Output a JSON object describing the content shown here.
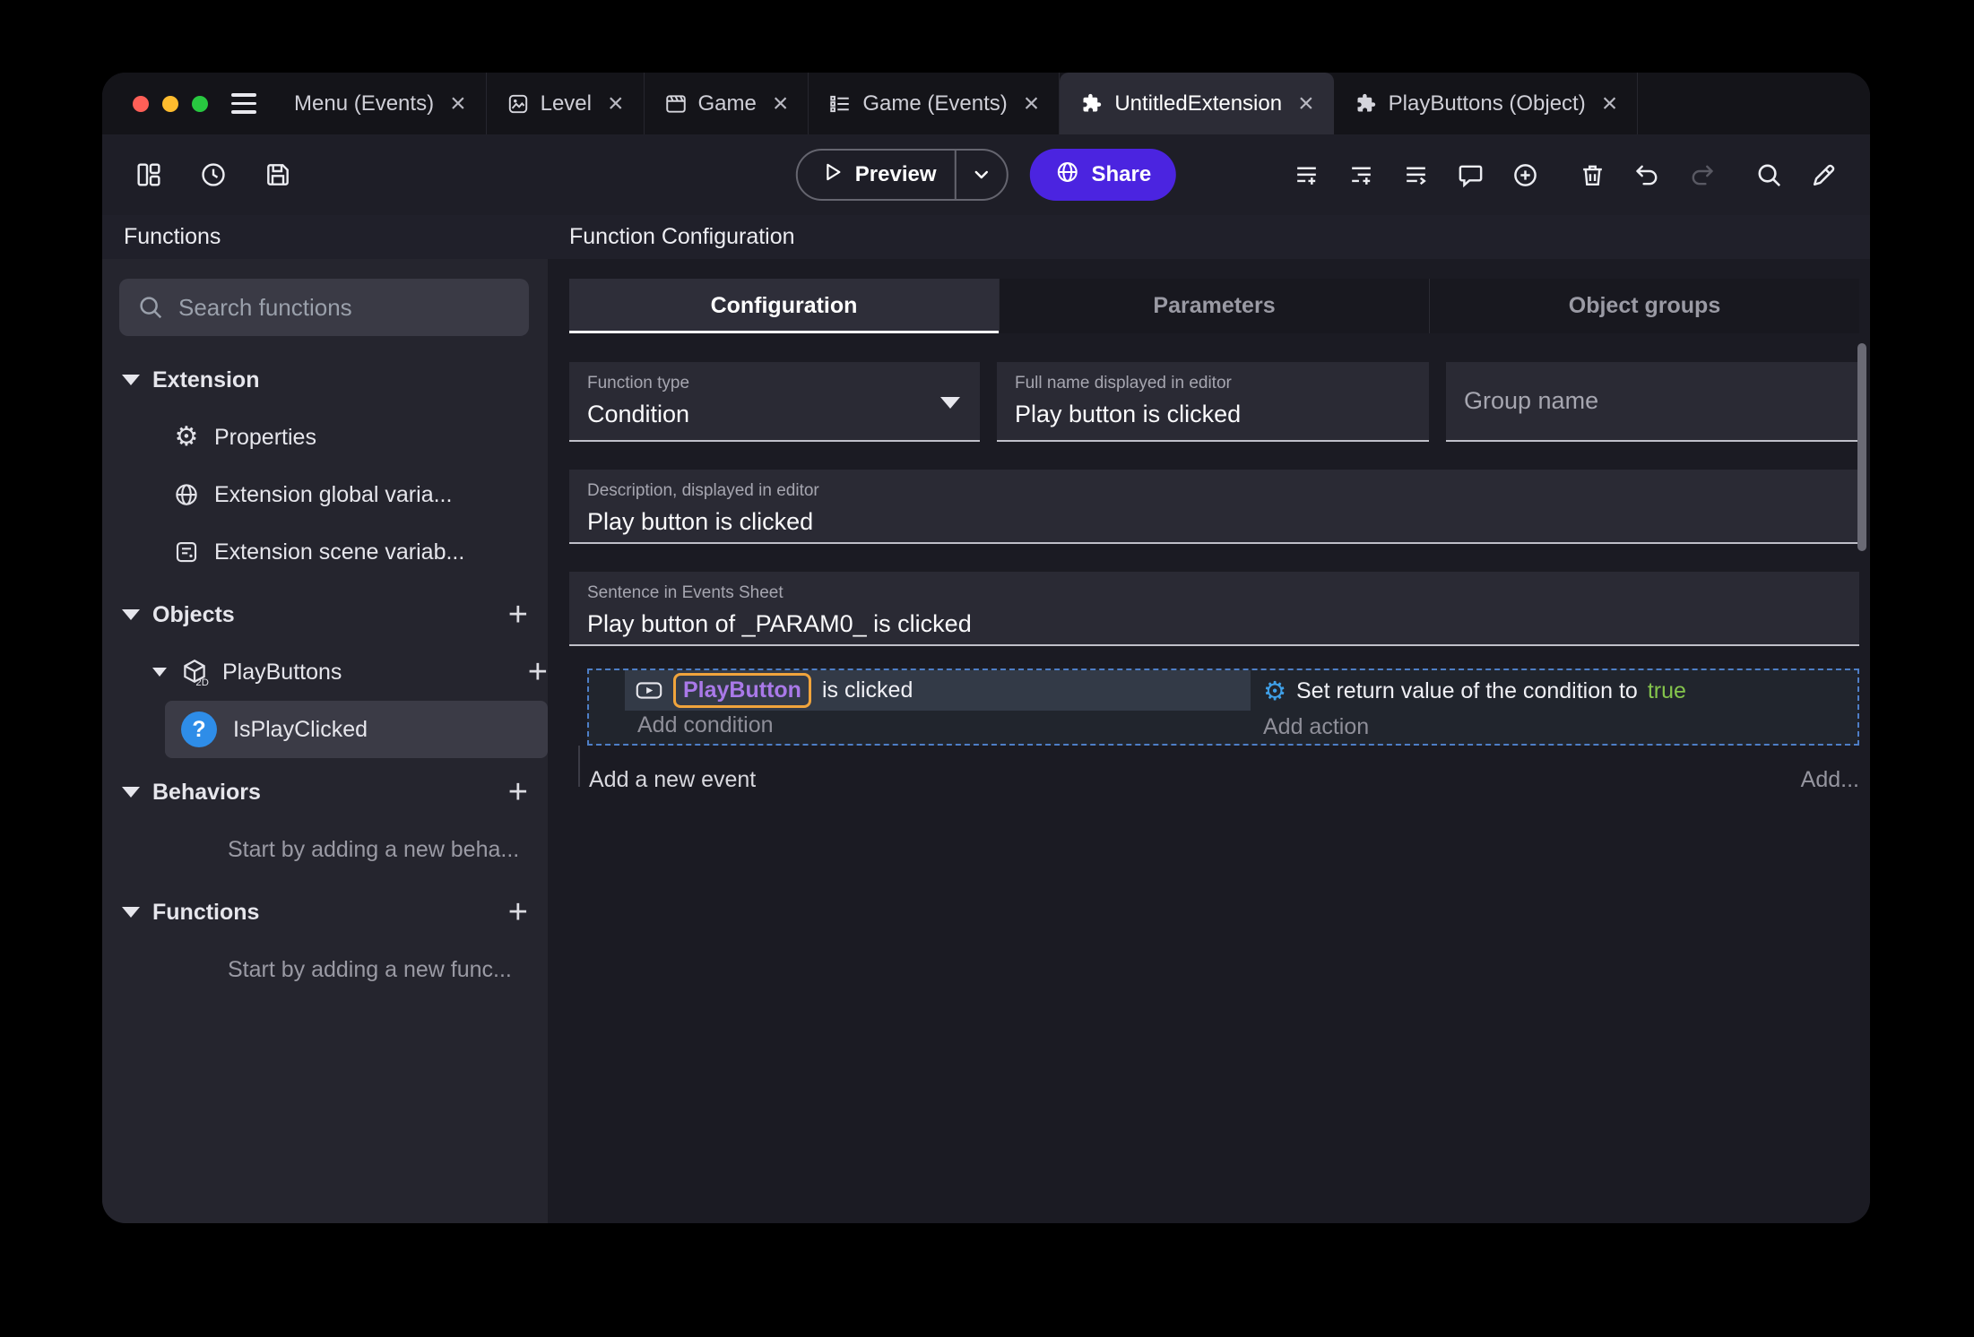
{
  "icons": {
    "close": "×",
    "plus": "+",
    "gear": "⚙",
    "question": "?"
  },
  "colors": {
    "share_button": "#4b24e0",
    "active_tab": "#2c2c36",
    "object_chip_border": "#f0a43c",
    "object_chip_text": "#a979e8",
    "condition_true_green": "#84c44c",
    "action_gear_blue": "#3fa0e8"
  },
  "tabbar": {
    "tabs": [
      {
        "label": "Menu (Events)"
      },
      {
        "label": "Level",
        "icon": "scene-icon"
      },
      {
        "label": "Game",
        "icon": "game-icon"
      },
      {
        "label": "Game (Events)",
        "icon": "events-sheet-icon"
      },
      {
        "label": "UntitledExtension",
        "icon": "extension-icon",
        "active": true
      },
      {
        "label": "PlayButtons (Object)",
        "icon": "extension-icon"
      }
    ]
  },
  "toolbar": {
    "preview_label": "Preview",
    "share_label": "Share"
  },
  "sidebar": {
    "title": "Functions",
    "search_placeholder": "Search functions",
    "tree": {
      "extension": {
        "label": "Extension",
        "items": [
          "Properties",
          "Extension global varia...",
          "Extension scene variab..."
        ]
      },
      "objects": {
        "label": "Objects",
        "object": {
          "label": "PlayButtons",
          "function": "IsPlayClicked"
        }
      },
      "behaviors": {
        "label": "Behaviors",
        "hint": "Start by adding a new beha..."
      },
      "functions": {
        "label": "Functions",
        "hint": "Start by adding a new func..."
      }
    }
  },
  "main": {
    "title": "Function Configuration",
    "tabs": [
      {
        "label": "Configuration",
        "active": true
      },
      {
        "label": "Parameters"
      },
      {
        "label": "Object groups"
      }
    ],
    "form": {
      "function_type": {
        "label": "Function type",
        "value": "Condition"
      },
      "full_name": {
        "label": "Full name displayed in editor",
        "value": "Play button is clicked"
      },
      "group_name": {
        "placeholder": "Group name"
      },
      "description": {
        "label": "Description, displayed in editor",
        "value": "Play button is clicked"
      },
      "sentence": {
        "label": "Sentence in Events Sheet",
        "value": "Play button of _PARAM0_ is clicked"
      }
    },
    "events": {
      "condition_object": "PlayButton",
      "condition_text": "is clicked",
      "add_condition": "Add condition",
      "action_prefix": "Set return value of the condition to ",
      "action_value": "true",
      "add_action": "Add action",
      "add_event": "Add a new event",
      "add_more": "Add..."
    }
  }
}
